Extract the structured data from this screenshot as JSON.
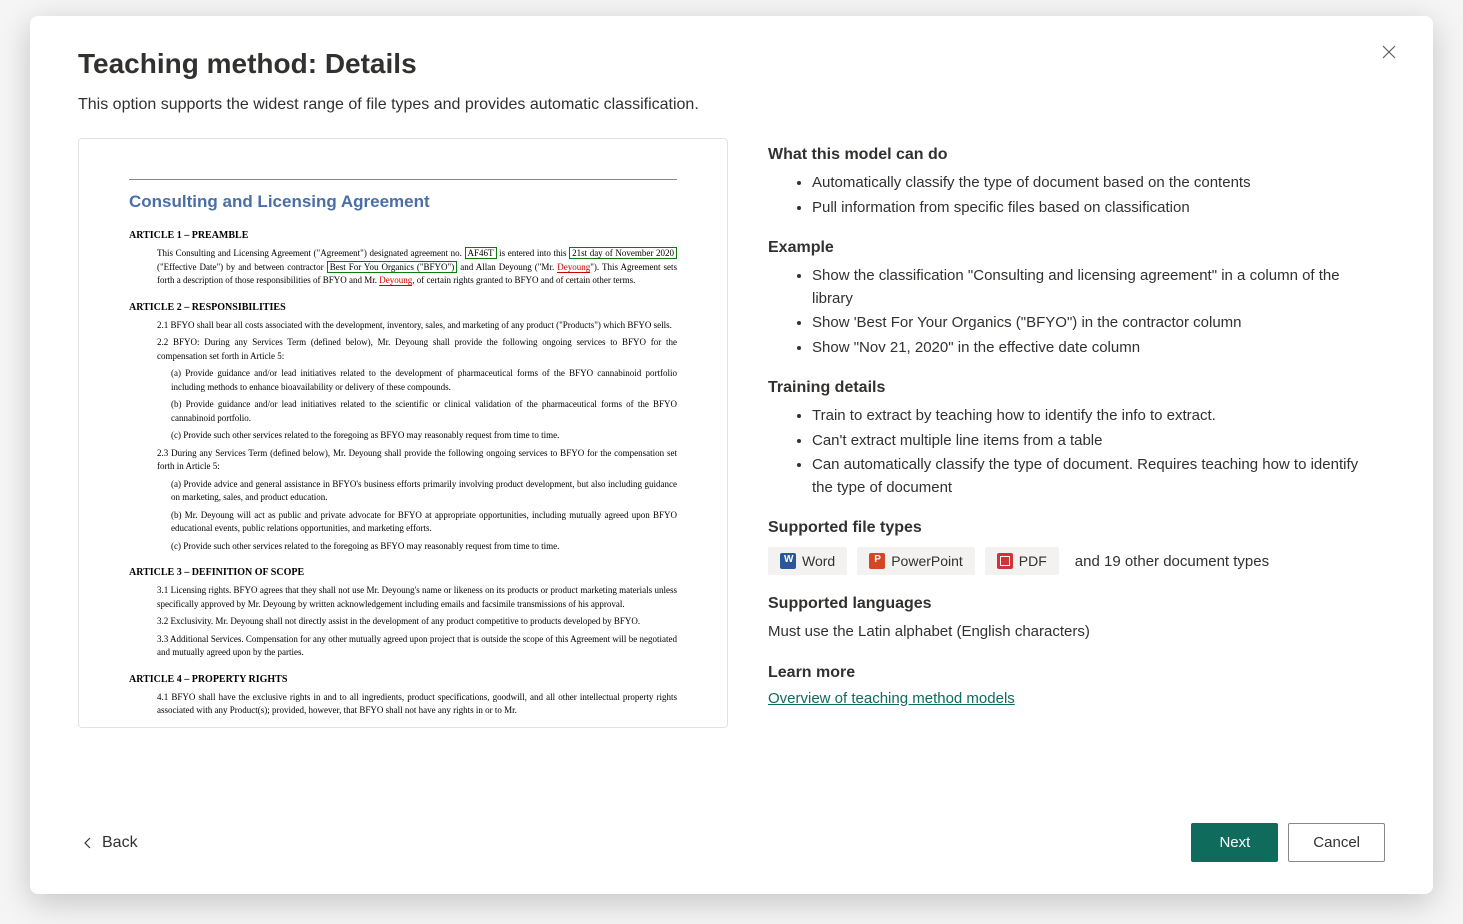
{
  "modal": {
    "title": "Teaching method: Details",
    "subtitle": "This option supports the widest range of file types and provides automatic classification.",
    "close_label": "Close"
  },
  "preview_doc": {
    "title": "Consulting and Licensing Agreement",
    "article1_heading": "ARTICLE 1 – PREAMBLE",
    "preamble_p1_a": "This Consulting and Licensing Agreement (\"Agreement\") designated agreement no. ",
    "preamble_hl1": "AF46T",
    "preamble_p1_b": " is entered into this ",
    "preamble_hl2": "21st day of November 2020",
    "preamble_p1_c": " (\"Effective Date\") by and between contractor ",
    "preamble_hl3": "Best For You Organics (\"BFYO\")",
    "preamble_p1_d": " and Allan Deyoung (\"Mr. ",
    "preamble_p1_e": "\"). This Agreement sets forth a description of those responsibilities of BFYO and Mr. ",
    "preamble_p1_f": ", of certain rights granted to BFYO and of certain other terms.",
    "redline_name": "Deyoung",
    "article2_heading": "ARTICLE 2 – RESPONSIBILITIES",
    "a2_1": "2.1 BFYO shall bear all costs associated with the development, inventory, sales, and marketing of any product (\"Products\") which BFYO sells.",
    "a2_2": "2.2 BFYO: During any Services Term (defined below), Mr. Deyoung shall provide the following ongoing services to BFYO for the compensation set forth in Article 5:",
    "a2_2a": "(a) Provide guidance and/or lead initiatives related to the development of pharmaceutical forms of the BFYO cannabinoid portfolio including methods to enhance bioavailability or delivery of these compounds.",
    "a2_2b": "(b) Provide guidance and/or lead initiatives related to the scientific or clinical validation of the pharmaceutical forms of the  BFYO cannabinoid portfolio.",
    "a2_2c": "(c) Provide such other services related to the foregoing as BFYO may reasonably request from time to time.",
    "a2_3": "2.3 During any Services Term (defined below), Mr. Deyoung shall provide the following ongoing services to BFYO for the compensation set forth in Article 5:",
    "a2_3a": "(a) Provide advice and general assistance in BFYO's business efforts primarily involving product development, but also including  guidance on marketing, sales, and product education.",
    "a2_3b": "(b) Mr. Deyoung will act as public and private advocate for BFYO at appropriate opportunities, including mutually agreed upon BFYO educational events, public relations opportunities, and marketing efforts.",
    "a2_3c": "(c) Provide such other services related to the foregoing as BFYO may reasonably request from time to time.",
    "article3_heading": "ARTICLE 3 – DEFINITION OF SCOPE",
    "a3_1": "3.1 Licensing rights. BFYO agrees that they shall not use Mr. Deyoung's name or likeness on its products or product marketing materials unless specifically approved by Mr. Deyoung by written acknowledgement including emails and facsimile transmissions of his approval.",
    "a3_2": "3.2 Exclusivity. Mr. Deyoung shall not directly assist in the development of any product competitive to products developed by BFYO.",
    "a3_3": "3.3 Additional Services. Compensation for any other mutually agreed upon project that is outside the scope of this Agreement will be negotiated and mutually agreed upon by the parties.",
    "article4_heading": "ARTICLE 4 – PROPERTY RIGHTS",
    "a4_1": "4.1 BFYO shall have the exclusive rights in and to all ingredients, product specifications, goodwill, and all other intellectual property rights associated with any Product(s); provided, however, that BFYO shall not have any rights in or to Mr."
  },
  "info": {
    "what_heading": "What this model can do",
    "what_items": [
      "Automatically classify the type of document based on the contents",
      "Pull information from specific files based on classification"
    ],
    "example_heading": "Example",
    "example_items": [
      "Show the classification \"Consulting and licensing agreement\" in a column of the library",
      "Show 'Best For Your Organics (\"BFYO\") in the contractor column",
      "Show \"Nov 21, 2020\" in the effective date column"
    ],
    "training_heading": "Training details",
    "training_items": [
      "Train to extract by teaching how to identify the info to extract.",
      "Can't extract multiple line items from a table",
      "Can automatically classify the type of document. Requires teaching how to identify the type of document"
    ],
    "filetypes_heading": "Supported file types",
    "filetype_word": "Word",
    "filetype_ppt": "PowerPoint",
    "filetype_pdf": "PDF",
    "filetypes_more": "and 19 other document types",
    "languages_heading": "Supported languages",
    "languages_text": "Must use the Latin alphabet (English characters)",
    "learnmore_heading": "Learn more",
    "learnmore_link": "Overview of teaching method models"
  },
  "footer": {
    "back_label": "Back",
    "next_label": "Next",
    "cancel_label": "Cancel"
  }
}
